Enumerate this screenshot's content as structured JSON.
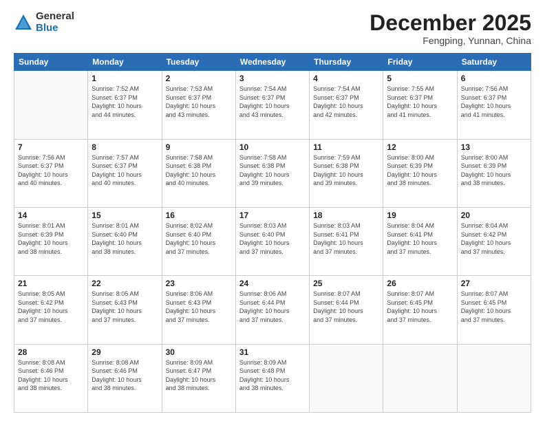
{
  "logo": {
    "general": "General",
    "blue": "Blue"
  },
  "header": {
    "month": "December 2025",
    "location": "Fengping, Yunnan, China"
  },
  "weekdays": [
    "Sunday",
    "Monday",
    "Tuesday",
    "Wednesday",
    "Thursday",
    "Friday",
    "Saturday"
  ],
  "weeks": [
    [
      {
        "day": "",
        "info": ""
      },
      {
        "day": "1",
        "info": "Sunrise: 7:52 AM\nSunset: 6:37 PM\nDaylight: 10 hours\nand 44 minutes."
      },
      {
        "day": "2",
        "info": "Sunrise: 7:53 AM\nSunset: 6:37 PM\nDaylight: 10 hours\nand 43 minutes."
      },
      {
        "day": "3",
        "info": "Sunrise: 7:54 AM\nSunset: 6:37 PM\nDaylight: 10 hours\nand 43 minutes."
      },
      {
        "day": "4",
        "info": "Sunrise: 7:54 AM\nSunset: 6:37 PM\nDaylight: 10 hours\nand 42 minutes."
      },
      {
        "day": "5",
        "info": "Sunrise: 7:55 AM\nSunset: 6:37 PM\nDaylight: 10 hours\nand 41 minutes."
      },
      {
        "day": "6",
        "info": "Sunrise: 7:56 AM\nSunset: 6:37 PM\nDaylight: 10 hours\nand 41 minutes."
      }
    ],
    [
      {
        "day": "7",
        "info": "Sunrise: 7:56 AM\nSunset: 6:37 PM\nDaylight: 10 hours\nand 40 minutes."
      },
      {
        "day": "8",
        "info": "Sunrise: 7:57 AM\nSunset: 6:37 PM\nDaylight: 10 hours\nand 40 minutes."
      },
      {
        "day": "9",
        "info": "Sunrise: 7:58 AM\nSunset: 6:38 PM\nDaylight: 10 hours\nand 40 minutes."
      },
      {
        "day": "10",
        "info": "Sunrise: 7:58 AM\nSunset: 6:38 PM\nDaylight: 10 hours\nand 39 minutes."
      },
      {
        "day": "11",
        "info": "Sunrise: 7:59 AM\nSunset: 6:38 PM\nDaylight: 10 hours\nand 39 minutes."
      },
      {
        "day": "12",
        "info": "Sunrise: 8:00 AM\nSunset: 6:39 PM\nDaylight: 10 hours\nand 38 minutes."
      },
      {
        "day": "13",
        "info": "Sunrise: 8:00 AM\nSunset: 6:39 PM\nDaylight: 10 hours\nand 38 minutes."
      }
    ],
    [
      {
        "day": "14",
        "info": "Sunrise: 8:01 AM\nSunset: 6:39 PM\nDaylight: 10 hours\nand 38 minutes."
      },
      {
        "day": "15",
        "info": "Sunrise: 8:01 AM\nSunset: 6:40 PM\nDaylight: 10 hours\nand 38 minutes."
      },
      {
        "day": "16",
        "info": "Sunrise: 8:02 AM\nSunset: 6:40 PM\nDaylight: 10 hours\nand 37 minutes."
      },
      {
        "day": "17",
        "info": "Sunrise: 8:03 AM\nSunset: 6:40 PM\nDaylight: 10 hours\nand 37 minutes."
      },
      {
        "day": "18",
        "info": "Sunrise: 8:03 AM\nSunset: 6:41 PM\nDaylight: 10 hours\nand 37 minutes."
      },
      {
        "day": "19",
        "info": "Sunrise: 8:04 AM\nSunset: 6:41 PM\nDaylight: 10 hours\nand 37 minutes."
      },
      {
        "day": "20",
        "info": "Sunrise: 8:04 AM\nSunset: 6:42 PM\nDaylight: 10 hours\nand 37 minutes."
      }
    ],
    [
      {
        "day": "21",
        "info": "Sunrise: 8:05 AM\nSunset: 6:42 PM\nDaylight: 10 hours\nand 37 minutes."
      },
      {
        "day": "22",
        "info": "Sunrise: 8:05 AM\nSunset: 6:43 PM\nDaylight: 10 hours\nand 37 minutes."
      },
      {
        "day": "23",
        "info": "Sunrise: 8:06 AM\nSunset: 6:43 PM\nDaylight: 10 hours\nand 37 minutes."
      },
      {
        "day": "24",
        "info": "Sunrise: 8:06 AM\nSunset: 6:44 PM\nDaylight: 10 hours\nand 37 minutes."
      },
      {
        "day": "25",
        "info": "Sunrise: 8:07 AM\nSunset: 6:44 PM\nDaylight: 10 hours\nand 37 minutes."
      },
      {
        "day": "26",
        "info": "Sunrise: 8:07 AM\nSunset: 6:45 PM\nDaylight: 10 hours\nand 37 minutes."
      },
      {
        "day": "27",
        "info": "Sunrise: 8:07 AM\nSunset: 6:45 PM\nDaylight: 10 hours\nand 37 minutes."
      }
    ],
    [
      {
        "day": "28",
        "info": "Sunrise: 8:08 AM\nSunset: 6:46 PM\nDaylight: 10 hours\nand 38 minutes."
      },
      {
        "day": "29",
        "info": "Sunrise: 8:08 AM\nSunset: 6:46 PM\nDaylight: 10 hours\nand 38 minutes."
      },
      {
        "day": "30",
        "info": "Sunrise: 8:09 AM\nSunset: 6:47 PM\nDaylight: 10 hours\nand 38 minutes."
      },
      {
        "day": "31",
        "info": "Sunrise: 8:09 AM\nSunset: 6:48 PM\nDaylight: 10 hours\nand 38 minutes."
      },
      {
        "day": "",
        "info": ""
      },
      {
        "day": "",
        "info": ""
      },
      {
        "day": "",
        "info": ""
      }
    ]
  ]
}
